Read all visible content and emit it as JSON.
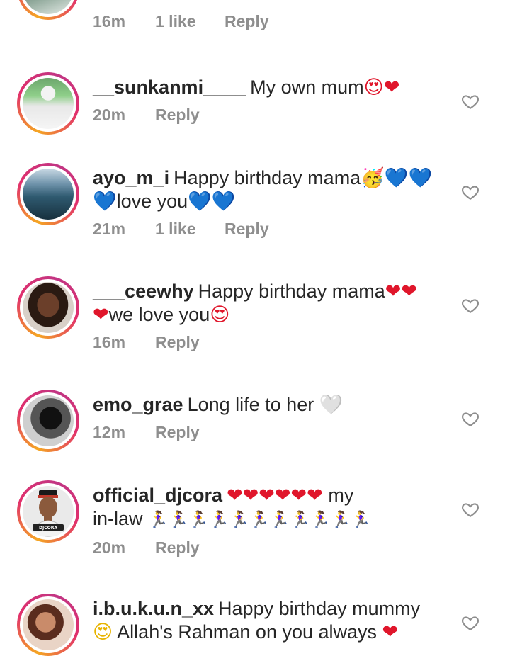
{
  "top_comment": {
    "time": "16m",
    "likes": "1 like",
    "reply_label": "Reply"
  },
  "comments": [
    {
      "username": "__sunkanmi____",
      "text": "My own mum",
      "emojis": "😍❤",
      "time": "20m",
      "likes": "",
      "reply_label": "Reply",
      "avatar": "person-in-hijab"
    },
    {
      "username": "ayo_m_i",
      "text": "Happy birthday mama",
      "emojis": "🥳💙💙",
      "text2": "love you",
      "emojis2_before": "💙",
      "emojis2_after": "💙💙",
      "time": "21m",
      "likes": "1 like",
      "reply_label": "Reply",
      "avatar": "ocean-view"
    },
    {
      "username": "___ceewhy",
      "text": "Happy birthday mama",
      "emojis": "❤❤",
      "text2": "we love you",
      "emojis2_before": "❤",
      "emojis2_after": "😍",
      "time": "16m",
      "likes": "",
      "reply_label": "Reply",
      "avatar": "portrait-woman"
    },
    {
      "username": "emo_grae",
      "text": "Long life to her",
      "emojis": "🤍",
      "time": "12m",
      "likes": "",
      "reply_label": "Reply",
      "avatar": "black-and-white-portrait"
    },
    {
      "username": "official_djcora",
      "text": "",
      "emojis": "❤❤❤❤❤❤",
      "text_after": "my",
      "text2": "in-law",
      "emojis2_after": "🏃‍♀️🏃‍♀️🏃‍♀️🏃‍♀️🏃‍♀️🏃‍♀️🏃‍♀️🏃‍♀️🏃‍♀️🏃‍♀️🏃‍♀️",
      "time": "20m",
      "likes": "",
      "reply_label": "Reply",
      "avatar": "djcora-cartoon"
    },
    {
      "username": "i.b.u.k.u.n_xx",
      "text": "Happy birthday mummy",
      "emojis": "",
      "text2": "Allah's Rahman on you always",
      "emojis2_before": "😍",
      "emojis2_after": "❤",
      "time": "",
      "likes": "",
      "reply_label": "",
      "avatar": "portrait-braids"
    }
  ],
  "icons": {
    "like": "heart-outline-icon"
  },
  "colors": {
    "text": "#262626",
    "meta": "#8e8e8e",
    "ring_start": "#f5a623",
    "ring_end": "#c13584"
  },
  "avatar_labels": {
    "djcora": "DJCORA"
  }
}
